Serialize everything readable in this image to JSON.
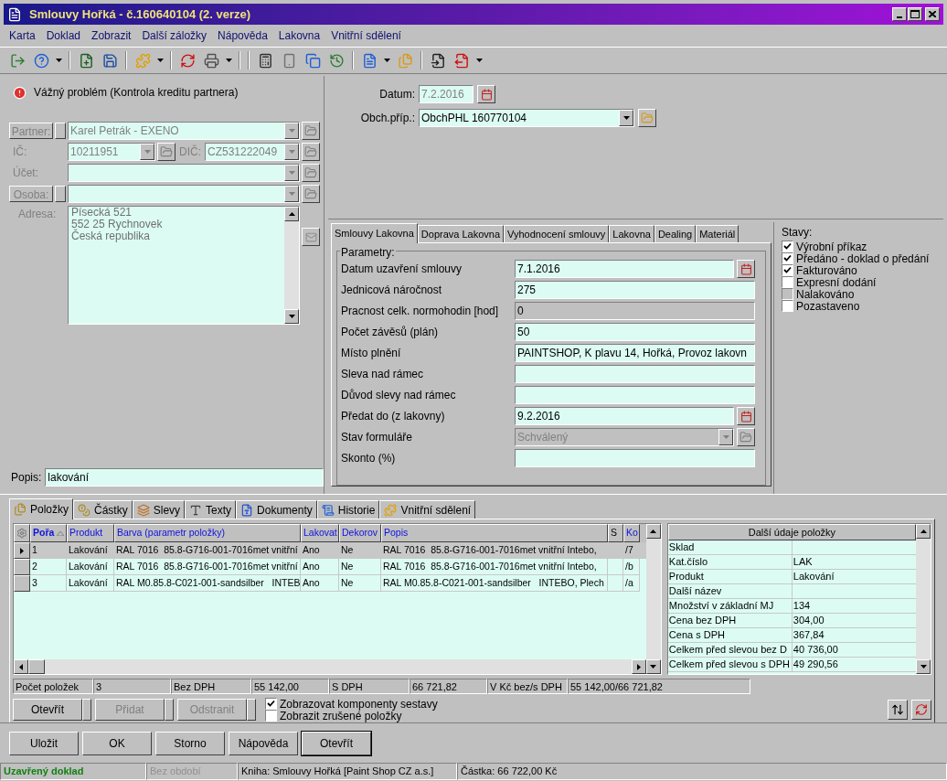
{
  "window": {
    "title": "Smlouvy Hořká - č.160640104 (2. verze)"
  },
  "menu": [
    "Karta",
    "Doklad",
    "Zobrazit",
    "Další záložky",
    "Nápověda",
    "Lakovna",
    "Vnitřní sdělení"
  ],
  "alert": {
    "text": "Vážný problém (Kontrola kreditu partnera)"
  },
  "partner_form": {
    "partner": {
      "label": "Partner:",
      "value": "Karel Petrák - EXENO"
    },
    "ic": {
      "label": "IČ:",
      "value": "10211951"
    },
    "dic": {
      "label": "DIČ:",
      "value": "CZ531222049"
    },
    "ucet": {
      "label": "Účet:"
    },
    "osoba": {
      "label": "Osoba:"
    },
    "address": {
      "label": "Adresa:",
      "lines": [
        "Písecká 521",
        "552 25 Rychnovek",
        "Česká republika"
      ]
    }
  },
  "popis": {
    "label": "Popis:",
    "value": "lakování"
  },
  "header": {
    "datum": {
      "label": "Datum:",
      "value": "7.2.2016"
    },
    "obch": {
      "label": "Obch.příp.:",
      "value": "ObchPHL 160770104"
    }
  },
  "top_tabs": [
    {
      "label": "Smlouvy Lakovna",
      "selected": true
    },
    {
      "label": "Doprava Lakovna",
      "selected": false
    },
    {
      "label": "Vyhodnocení smlouvy",
      "selected": false
    },
    {
      "label": "Lakovna",
      "selected": false
    },
    {
      "label": "Dealing",
      "selected": false
    },
    {
      "label": "Materiál",
      "selected": false
    }
  ],
  "parametry": {
    "title": "Parametry:",
    "fields": [
      {
        "label": "Datum uzavření smlouvy",
        "value": "7.1.2016",
        "kind": "date"
      },
      {
        "label": "Jednicová náročnost",
        "value": "275",
        "kind": "text"
      },
      {
        "label": "Pracnost celk. normohodin [hod]",
        "value": "0",
        "kind": "readonly"
      },
      {
        "label": "Počet závěsů (plán)",
        "value": "50",
        "kind": "text"
      },
      {
        "label": "Místo plnění",
        "value": "PAINTSHOP, K plavu 14, Hořká, Provoz lakovn",
        "kind": "text"
      },
      {
        "label": "Sleva nad rámec",
        "kind": "text"
      },
      {
        "label": "Důvod slevy nad rámec",
        "kind": "text"
      },
      {
        "label": "Předat do (z lakovny)",
        "value": "9.2.2016",
        "kind": "date"
      },
      {
        "label": "Stav formuláře",
        "value": "Schválený",
        "kind": "select"
      },
      {
        "label": "Skonto (%)",
        "kind": "text"
      }
    ]
  },
  "stavy": {
    "title": "Stavy:",
    "items": [
      {
        "label": "Výrobní příkaz",
        "checked": true,
        "disabled": false
      },
      {
        "label": "Předáno - doklad o předání",
        "checked": true,
        "disabled": false
      },
      {
        "label": "Fakturováno",
        "checked": true,
        "disabled": false
      },
      {
        "label": "Expresní dodání",
        "checked": false,
        "disabled": false
      },
      {
        "label": "Nalakováno",
        "checked": false,
        "disabled": true
      },
      {
        "label": "Pozastaveno",
        "checked": false,
        "disabled": false
      }
    ]
  },
  "bottom_tabs": [
    {
      "label": "Položky",
      "selected": true
    },
    {
      "label": "Částky",
      "selected": false
    },
    {
      "label": "Slevy",
      "selected": false
    },
    {
      "label": "Texty",
      "selected": false
    },
    {
      "label": "Dokumenty",
      "selected": false
    },
    {
      "label": "Historie",
      "selected": false
    },
    {
      "label": "Vnitřní sdělení",
      "selected": false
    }
  ],
  "items_table": {
    "columns": [
      {
        "label": "Pořa",
        "sorted": true
      },
      {
        "label": "Produkt",
        "sorted": false
      },
      {
        "label": "Barva (parametr položky)",
        "sorted": false
      },
      {
        "label": "Lakovat",
        "sorted": false
      },
      {
        "label": "Dekorov",
        "sorted": false
      },
      {
        "label": "Popis",
        "sorted": false
      },
      {
        "label": "S",
        "sorted": false
      },
      {
        "label": "Ko",
        "sorted": false
      }
    ],
    "rows": [
      {
        "selected": true,
        "cells": [
          "1",
          "Lakování",
          "RAL 7016  85.8-G716-001-7016met vnitřní",
          "Ano",
          "Ne",
          "RAL 7016  85.8-G716-001-7016met vnitřní Intebo,",
          "",
          "/7"
        ]
      },
      {
        "selected": false,
        "cells": [
          "2",
          "Lakování",
          "RAL 7016  85.8-G716-001-7016met vnitřní",
          "Ano",
          "Ne",
          "RAL 7016  85.8-G716-001-7016met vnitřní Intebo,",
          "",
          "/b"
        ]
      },
      {
        "selected": false,
        "cells": [
          "3",
          "Lakování",
          "RAL M0.85.8-C021-001-sandsilber   INTEB",
          "Ano",
          "Ne",
          "RAL M0.85.8-C021-001-sandsilber   INTEBO, Plech",
          "",
          "/a"
        ]
      }
    ]
  },
  "detail": {
    "title": "Další údaje položky",
    "rows": [
      {
        "label": "Sklad"
      },
      {
        "label": "Kat.číslo",
        "value": "LAK"
      },
      {
        "label": "Produkt",
        "value": "Lakování"
      },
      {
        "label": "Další název"
      },
      {
        "label": "Množství v základní MJ",
        "value": "134"
      },
      {
        "label": "Cena bez DPH",
        "value": "304,00"
      },
      {
        "label": "Cena s DPH",
        "value": "367,84"
      },
      {
        "label": "Celkem před slevou bez D",
        "value": "40 736,00"
      },
      {
        "label": "Celkem před slevou s DPH",
        "value": "49 290,56"
      }
    ]
  },
  "summary": [
    {
      "label": "Počet položek",
      "value": "3"
    },
    {
      "label": "Bez DPH",
      "value": "55 142,00"
    },
    {
      "label": "S DPH",
      "value": "66 721,82"
    },
    {
      "label": "V Kč bez/s DPH",
      "value": "55 142,00/66 721,82"
    }
  ],
  "item_buttons": [
    {
      "label": "Otevřít",
      "disabled": false
    },
    {
      "label": "Přidat",
      "disabled": true
    },
    {
      "label": "Odstranit",
      "disabled": true
    }
  ],
  "options": [
    {
      "label": "Zobrazovat komponenty sestavy",
      "checked": true
    },
    {
      "label": "Zobrazit zrušené položky",
      "checked": false
    }
  ],
  "buttons": [
    {
      "label": "Uložit",
      "default": false
    },
    {
      "label": "OK",
      "default": false
    },
    {
      "label": "Storno",
      "default": false
    },
    {
      "label": "Nápověda",
      "default": false
    },
    {
      "label": "Otevřít",
      "default": true
    }
  ],
  "status_bar": [
    {
      "text": "Uzavřený doklad",
      "kind": "ok"
    },
    {
      "text": "Bez období",
      "kind": "muted"
    },
    {
      "text": "Kniha: Smlouvy Hořká [Paint Shop CZ a.s.]",
      "kind": "normal"
    },
    {
      "text": "Částka: 66 722,00 Kč",
      "kind": "normal"
    }
  ]
}
